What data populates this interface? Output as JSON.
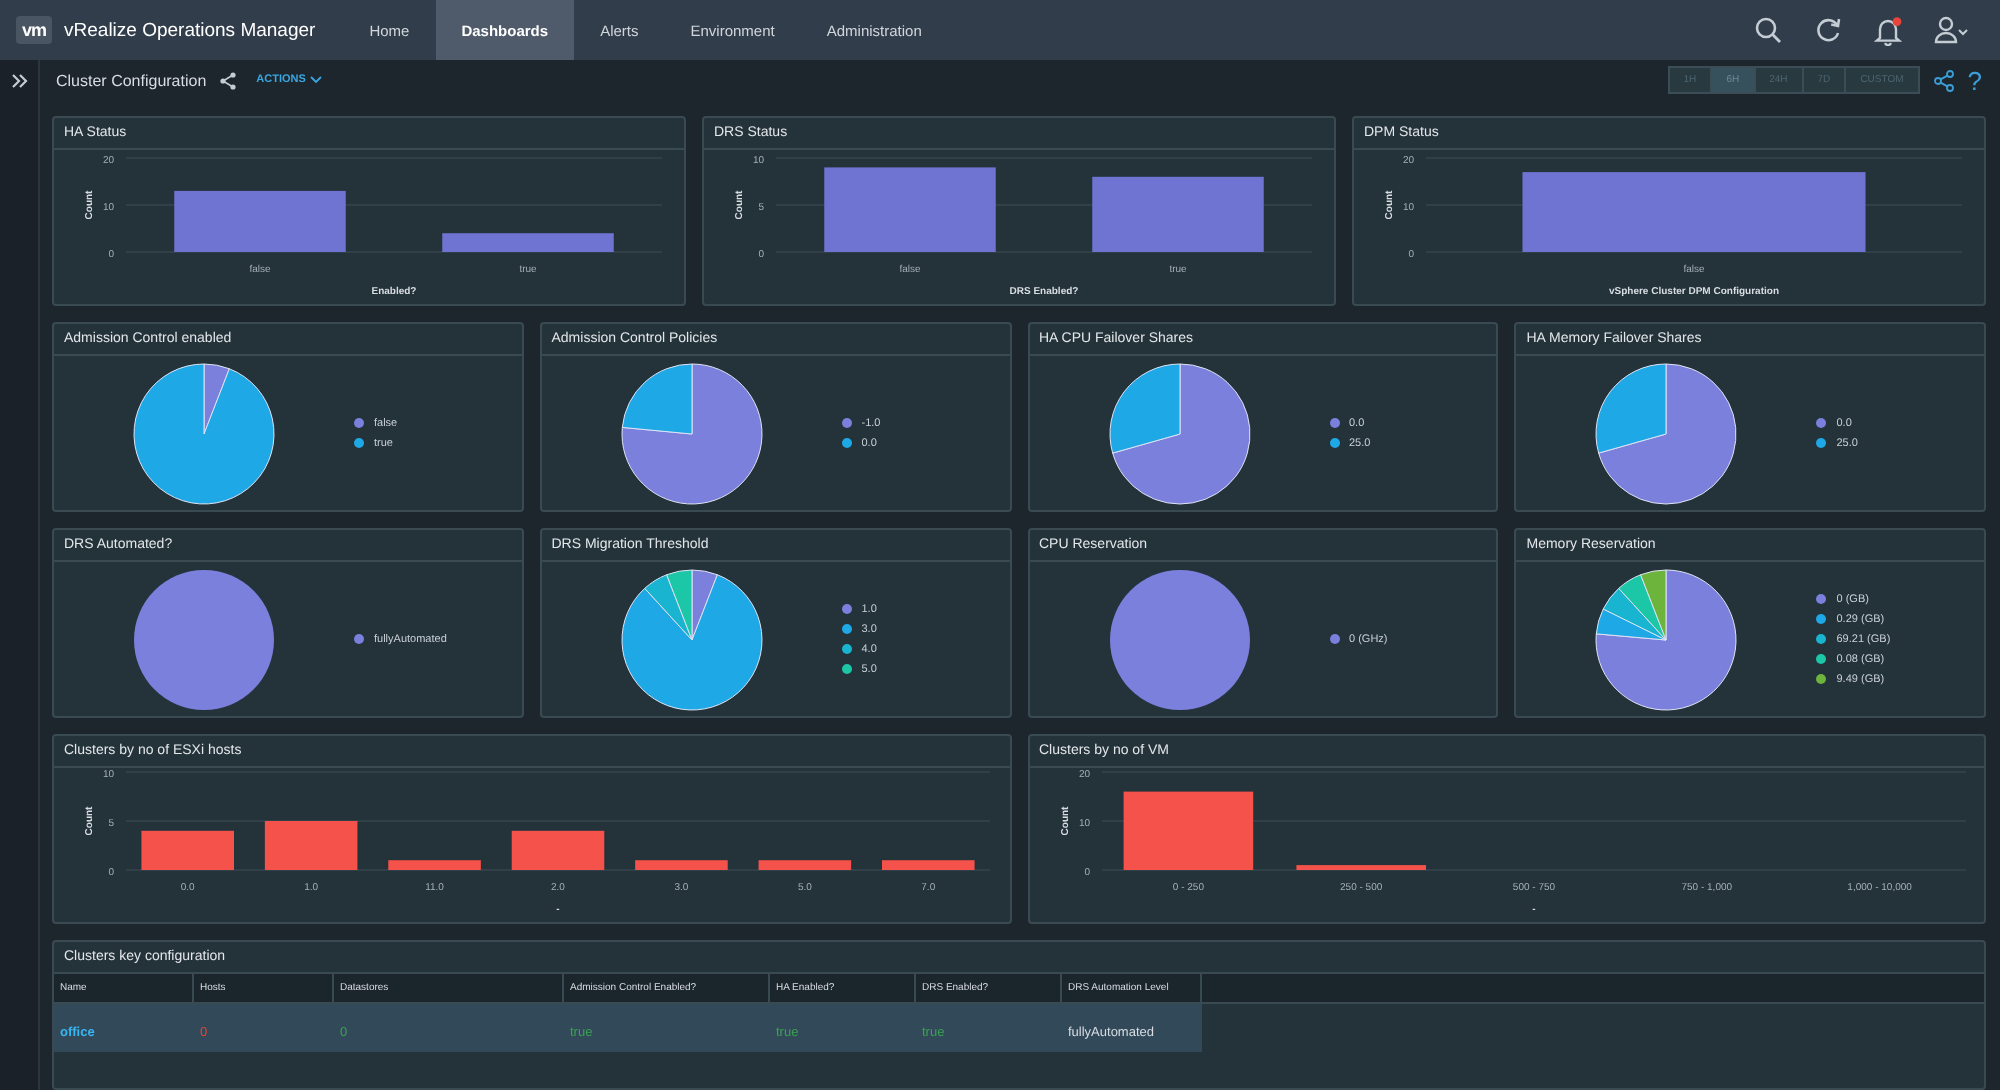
{
  "nav": {
    "logo": "vm",
    "product": "vRealize Operations Manager",
    "tabs": [
      {
        "label": "Home",
        "selected": false
      },
      {
        "label": "Dashboards",
        "selected": true
      },
      {
        "label": "Alerts",
        "selected": false
      },
      {
        "label": "Environment",
        "selected": false
      },
      {
        "label": "Administration",
        "selected": false
      }
    ],
    "notification": true
  },
  "dashboard": {
    "title": "Cluster Configuration",
    "actions": "ACTIONS",
    "time_ranges": [
      {
        "label": "1H",
        "selected": false
      },
      {
        "label": "6H",
        "selected": true
      },
      {
        "label": "24H",
        "selected": false
      },
      {
        "label": "7D",
        "selected": false
      },
      {
        "label": "CUSTOM",
        "selected": false
      }
    ],
    "help": "?"
  },
  "status_panels": [
    {
      "title": "HA Status",
      "chart_data": {
        "type": "bar",
        "xlabel": "Enabled?",
        "ylabel": "Count",
        "categories": [
          "false",
          "true"
        ],
        "values": [
          13,
          4
        ],
        "ylim": [
          0,
          20
        ],
        "yticks": [
          0,
          10,
          20
        ],
        "color": "#6f73d2"
      }
    },
    {
      "title": "DRS Status",
      "chart_data": {
        "type": "bar",
        "xlabel": "DRS Enabled?",
        "ylabel": "Count",
        "categories": [
          "false",
          "true"
        ],
        "values": [
          9,
          8
        ],
        "ylim": [
          0,
          10
        ],
        "yticks": [
          0,
          5,
          10
        ],
        "color": "#6f73d2"
      }
    },
    {
      "title": "DPM Status",
      "chart_data": {
        "type": "bar",
        "xlabel": "vSphere Cluster DPM Configuration",
        "ylabel": "Count",
        "categories": [
          "false"
        ],
        "values": [
          17
        ],
        "ylim": [
          0,
          20
        ],
        "yticks": [
          0,
          10,
          20
        ],
        "color": "#6f73d2"
      }
    }
  ],
  "pie_panels": [
    {
      "title": "Admission Control enabled",
      "chart_data": {
        "type": "pie",
        "categories": [
          "false",
          "true"
        ],
        "values": [
          5.9,
          94.1
        ],
        "legend": "right",
        "colors": [
          "#7b80dc",
          "#1ea8e6"
        ]
      }
    },
    {
      "title": "Admission Control Policies",
      "chart_data": {
        "type": "pie",
        "categories": [
          "-1.0",
          "0.0"
        ],
        "values": [
          76.5,
          23.5
        ],
        "legend": "right",
        "colors": [
          "#7b80dc",
          "#1ea8e6"
        ]
      }
    },
    {
      "title": "HA CPU Failover Shares",
      "chart_data": {
        "type": "pie",
        "categories": [
          "0.0",
          "25.0"
        ],
        "values": [
          70.6,
          29.4
        ],
        "legend": "right",
        "colors": [
          "#7b80dc",
          "#1ea8e6"
        ]
      }
    },
    {
      "title": "HA Memory Failover Shares",
      "chart_data": {
        "type": "pie",
        "categories": [
          "0.0",
          "25.0"
        ],
        "values": [
          70.6,
          29.4
        ],
        "legend": "right",
        "colors": [
          "#7b80dc",
          "#1ea8e6"
        ]
      }
    },
    {
      "title": "DRS Automated?",
      "chart_data": {
        "type": "pie",
        "categories": [
          "fullyAutomated"
        ],
        "values": [
          100
        ],
        "legend": "right",
        "colors": [
          "#7b80dc"
        ]
      }
    },
    {
      "title": "DRS Migration Threshold",
      "chart_data": {
        "type": "pie",
        "categories": [
          "1.0",
          "3.0",
          "4.0",
          "5.0"
        ],
        "values": [
          5.9,
          82.3,
          5.9,
          5.9
        ],
        "legend": "right",
        "colors": [
          "#7b80dc",
          "#1ea8e6",
          "#19b4cf",
          "#1cc7a8"
        ]
      }
    },
    {
      "title": "CPU Reservation",
      "chart_data": {
        "type": "pie",
        "categories": [
          "0 (GHz)"
        ],
        "values": [
          100
        ],
        "legend": "right",
        "colors": [
          "#7b80dc"
        ]
      }
    },
    {
      "title": "Memory Reservation",
      "chart_data": {
        "type": "pie",
        "categories": [
          "0 (GB)",
          "0.29 (GB)",
          "69.21 (GB)",
          "0.08 (GB)",
          "9.49 (GB)"
        ],
        "values": [
          76.4,
          5.9,
          5.9,
          5.9,
          5.9
        ],
        "legend": "right",
        "colors": [
          "#7b80dc",
          "#1ea8e6",
          "#19b4cf",
          "#1cc7a8",
          "#6cb43c"
        ]
      }
    }
  ],
  "cluster_panels": [
    {
      "title": "Clusters by no of ESXi hosts",
      "chart_data": {
        "type": "bar",
        "xlabel": "-",
        "ylabel": "Count",
        "categories": [
          "0.0",
          "1.0",
          "11.0",
          "2.0",
          "3.0",
          "5.0",
          "7.0"
        ],
        "values": [
          4,
          5,
          1,
          4,
          1,
          1,
          1
        ],
        "ylim": [
          0,
          10
        ],
        "yticks": [
          0,
          5,
          10
        ],
        "color": "#f4524a"
      }
    },
    {
      "title": "Clusters by no of VM",
      "chart_data": {
        "type": "bar",
        "xlabel": "-",
        "ylabel": "Count",
        "categories": [
          "0 - 250",
          "250 - 500",
          "500 - 750",
          "750 - 1,000",
          "1,000 - 10,000"
        ],
        "values": [
          16,
          1,
          0,
          0,
          0
        ],
        "ylim": [
          0,
          20
        ],
        "yticks": [
          0,
          10,
          20
        ],
        "color": "#f4524a"
      }
    }
  ],
  "table": {
    "title": "Clusters key configuration",
    "columns": [
      "Name",
      "Hosts",
      "Datastores",
      "Admission Control Enabled?",
      "HA Enabled?",
      "DRS Enabled?",
      "DRS Automation Level"
    ],
    "rows": [
      {
        "selected": true,
        "cells": [
          {
            "text": "office",
            "color": "#39b5f0",
            "kind": "link"
          },
          {
            "text": "0",
            "color": "#e0453b"
          },
          {
            "text": "0",
            "color": "#3aa350"
          },
          {
            "text": "true",
            "color": "#3aa350"
          },
          {
            "text": "true",
            "color": "#3aa350"
          },
          {
            "text": "true",
            "color": "#3aa350"
          },
          {
            "text": "fullyAutomated",
            "color": "#d8dde2"
          }
        ]
      }
    ]
  }
}
